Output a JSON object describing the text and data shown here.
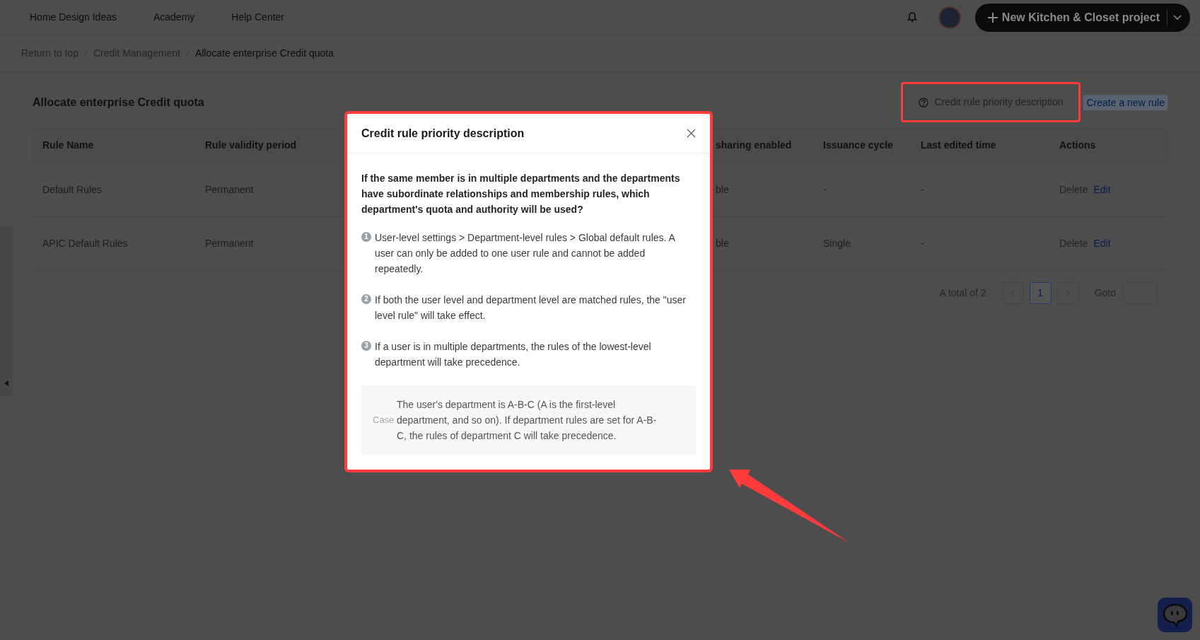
{
  "top_nav": {
    "links": [
      "Home Design Ideas",
      "Academy",
      "Help Center"
    ],
    "new_project_button": "New Kitchen & Closet project"
  },
  "breadcrumb": [
    {
      "label": "Return to top",
      "current": false
    },
    {
      "label": "Credit Management",
      "current": false
    },
    {
      "label": "Allocate enterprise Credit quota",
      "current": true
    }
  ],
  "page_title": "Allocate enterprise Credit quota",
  "priority_button": "Credit rule priority description",
  "create_button": "Create a new rule",
  "table": {
    "columns": [
      "Rule Name",
      "Rule validity period",
      "sharing enabled",
      "Issuance cycle",
      "Last edited time",
      "Actions"
    ],
    "rows": [
      {
        "cells": [
          "Default Rules",
          "Permanent",
          "ble",
          "-",
          "-"
        ],
        "actions": [
          {
            "label": "Delete",
            "disabled": true
          },
          {
            "label": "Edit",
            "disabled": false
          }
        ]
      },
      {
        "cells": [
          "APIC Default Rules",
          "Permanent",
          "ble",
          "Single",
          "-"
        ],
        "actions": [
          {
            "label": "Delete",
            "disabled": true
          },
          {
            "label": "Edit",
            "disabled": false
          }
        ]
      }
    ]
  },
  "pagination": {
    "total": "A total of 2",
    "pages": [
      {
        "label": "1",
        "selected": true
      }
    ],
    "goto": "Goto"
  },
  "modal": {
    "title": "Credit rule priority description",
    "question": "If the same member is in multiple departments and the departments have subordinate relationships and membership rules, which department's quota and authority will be used?",
    "items": [
      {
        "number": "1",
        "text": "User-level settings > Department-level rules > Global default rules. A user can only be added to one user rule and cannot be added repeatedly."
      },
      {
        "number": "2",
        "text": "If both the user level and department level are matched rules, the \"user level rule\" will take effect."
      },
      {
        "number": "3",
        "text": "If a user is in multiple departments, the rules of the lowest-level department will take precedence."
      }
    ],
    "case": {
      "label": "Case",
      "text": "The user's department is A-B-C (A is the first-level department, and so on). If department rules are set for A-B-C, the rules of department C will take precedence."
    }
  }
}
